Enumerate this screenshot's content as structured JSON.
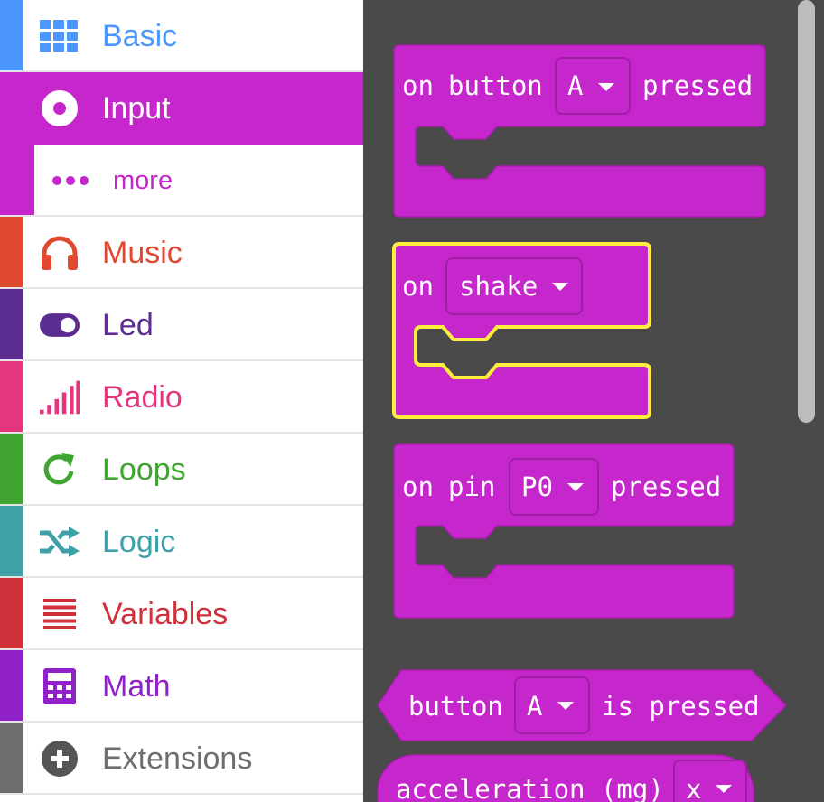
{
  "toolbox": {
    "categories": [
      {
        "label": "Basic",
        "color": "#4c97ff",
        "icon": "grid-icon"
      },
      {
        "label": "Input",
        "color": "#c527cc",
        "icon": "target-icon",
        "selected": true
      },
      {
        "label": "more",
        "color": "#c527cc",
        "icon": "ellipsis-icon",
        "sub": true
      },
      {
        "label": "Music",
        "color": "#e0492f",
        "icon": "headphones-icon"
      },
      {
        "label": "Led",
        "color": "#5c2d91",
        "icon": "toggle-icon"
      },
      {
        "label": "Radio",
        "color": "#e3367e",
        "icon": "signal-bars-icon"
      },
      {
        "label": "Loops",
        "color": "#3fa430",
        "icon": "refresh-icon"
      },
      {
        "label": "Logic",
        "color": "#40a0a8",
        "icon": "shuffle-icon"
      },
      {
        "label": "Variables",
        "color": "#d0303a",
        "icon": "list-lines-icon"
      },
      {
        "label": "Math",
        "color": "#9020c8",
        "icon": "calculator-icon"
      },
      {
        "label": "Extensions",
        "color": "#6e6e6e",
        "icon": "plus-circle-icon"
      }
    ]
  },
  "blocks": {
    "on_button_pressed": {
      "word1": "on",
      "word2": "button",
      "dropdown": "A",
      "suffix": "pressed"
    },
    "on_shake": {
      "word1": "on",
      "dropdown": "shake"
    },
    "on_pin_pressed": {
      "word1": "on",
      "word2": "pin",
      "dropdown": "P0",
      "suffix": "pressed"
    },
    "button_is_pressed": {
      "word1": "button",
      "dropdown": "A",
      "suffix": "is pressed"
    },
    "acceleration": {
      "label": "acceleration (mg)",
      "dropdown": "x"
    }
  },
  "colors": {
    "input_block": "#c527cc",
    "block_border": "#9f1fa4",
    "highlight": "#ffef3c",
    "workspace": "#4a4a4a"
  }
}
